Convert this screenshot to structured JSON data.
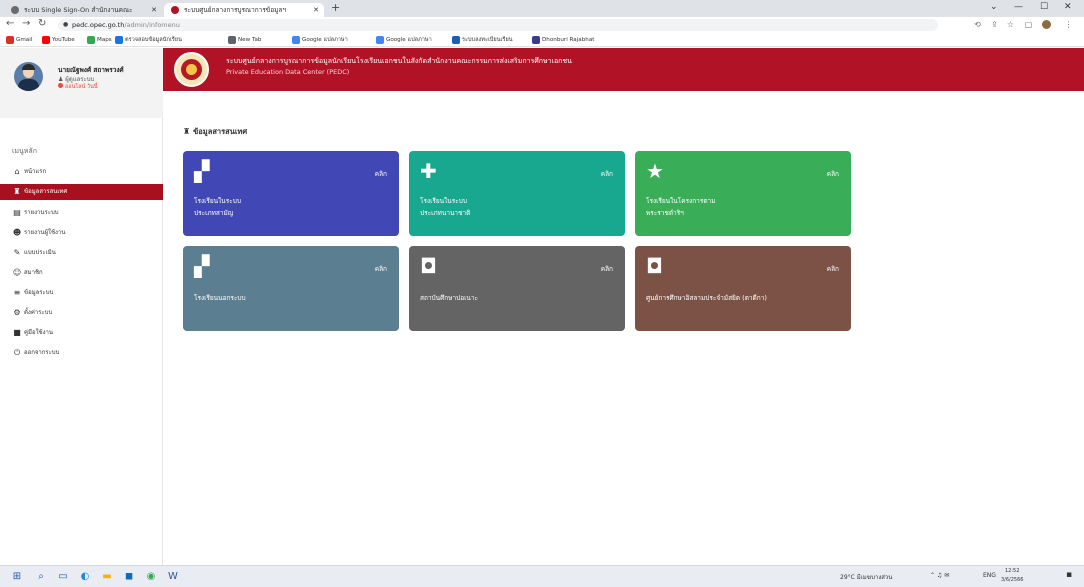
{
  "browser": {
    "tabs": [
      {
        "label": "ระบบ Single Sign-On สำนักงานคณะ",
        "favicon_color": "#6b6b6b"
      },
      {
        "label": "ระบบศูนย์กลางการบูรณาการข้อมูลฯ",
        "favicon_color": "#b11226"
      }
    ],
    "new_tab": "+",
    "url_host": "pedc.opec.go.th",
    "url_path": "/admin/infomenu",
    "bookmarks": [
      {
        "label": "Gmail",
        "color": "#d93025"
      },
      {
        "label": "YouTube",
        "color": "#ff0000"
      },
      {
        "label": "Maps",
        "color": "#34a853"
      },
      {
        "label": "ตรวจสอบข้อมูลนักเรียน",
        "color": "#1a73e8"
      },
      {
        "label": "New Tab",
        "color": "#5f6368"
      },
      {
        "label": "Google แปลภาษา",
        "color": "#4285f4"
      },
      {
        "label": "Google แปลภาษา",
        "color": "#4285f4"
      },
      {
        "label": "ระบบลงทะเบียนเรียน",
        "color": "#1a5fb4"
      },
      {
        "label": "Dhonburi Rajabhat",
        "color": "#3c3c8c"
      }
    ]
  },
  "profile": {
    "name": "นายณัฐพงศ์ สถาพรวงศ์",
    "role": "ผู้ดูแลระบบ",
    "status": "ออนไลน์ วันนี้"
  },
  "sidebar": {
    "heading": "เมนูหลัก",
    "items": [
      {
        "label": "หน้าแรก",
        "icon": "home-icon",
        "glyph": "⌂",
        "active": false
      },
      {
        "label": "ข้อมูลสารสนเทศ",
        "icon": "school-icon",
        "glyph": "♜",
        "active": true
      },
      {
        "label": "รายงานระบบ",
        "icon": "chart-icon",
        "glyph": "▤",
        "active": false
      },
      {
        "label": "รายงานผู้ใช้งาน",
        "icon": "users-icon",
        "glyph": "☻",
        "active": false
      },
      {
        "label": "แบบประเมิน",
        "icon": "pen-icon",
        "glyph": "✎",
        "active": false
      },
      {
        "label": "สมาชิก",
        "icon": "member-icon",
        "glyph": "☺",
        "active": false
      },
      {
        "label": "ข้อมูลระบบ",
        "icon": "database-icon",
        "glyph": "≡",
        "active": false
      },
      {
        "label": "ตั้งค่าระบบ",
        "icon": "settings-icon",
        "glyph": "⚙",
        "active": false
      },
      {
        "label": "คู่มือใช้งาน",
        "icon": "book-icon",
        "glyph": "■",
        "active": false
      },
      {
        "label": "ออกจากระบบ",
        "icon": "power-icon",
        "glyph": "⏻",
        "active": false
      }
    ]
  },
  "banner": {
    "title_th": "ระบบศูนย์กลางการบูรณาการข้อมูลนักเรียนโรงเรียนเอกชนในสังกัดสำนักงานคณะกรรมการส่งเสริมการศึกษาเอกชน",
    "title_en": "Private Education Data Center (PEDC)"
  },
  "main": {
    "section_title": "ข้อมูลสารสนเทศ",
    "cards": [
      {
        "label1": "โรงเรียนในระบบ",
        "label2": "ประเภทสามัญ",
        "more": "คลิก",
        "icon": "school-building-icon",
        "glyph": "▞",
        "color": "#4148b5"
      },
      {
        "label1": "โรงเรียนในระบบ",
        "label2": "ประเภทนานาชาติ",
        "more": "คลิก",
        "icon": "church-icon",
        "glyph": "✚",
        "color": "#17a88f"
      },
      {
        "label1": "โรงเรียนในโครงการตาม",
        "label2": "พระราชดำริฯ",
        "more": "คลิก",
        "icon": "star-icon",
        "glyph": "★",
        "color": "#3aad58"
      },
      {
        "label1": "โรงเรียนนอกระบบ",
        "label2": "",
        "more": "คลิก",
        "icon": "school-building-icon",
        "glyph": "▞",
        "color": "#5b7f90"
      },
      {
        "label1": "สถาบันศึกษาปอเนาะ",
        "label2": "",
        "more": "คลิก",
        "icon": "mosque-icon",
        "glyph": "◘",
        "color": "#646464"
      },
      {
        "label1": "ศูนย์การศึกษาอิสลามประจำมัสยิด (ตาดีกา)",
        "label2": "",
        "more": "คลิก",
        "icon": "mosque-icon",
        "glyph": "◘",
        "color": "#7d5246"
      }
    ]
  },
  "taskbar": {
    "weather": "29°C มีเมฆบางส่วน",
    "lang": "ENG",
    "time": "12:52",
    "date": "3/6/2566"
  }
}
